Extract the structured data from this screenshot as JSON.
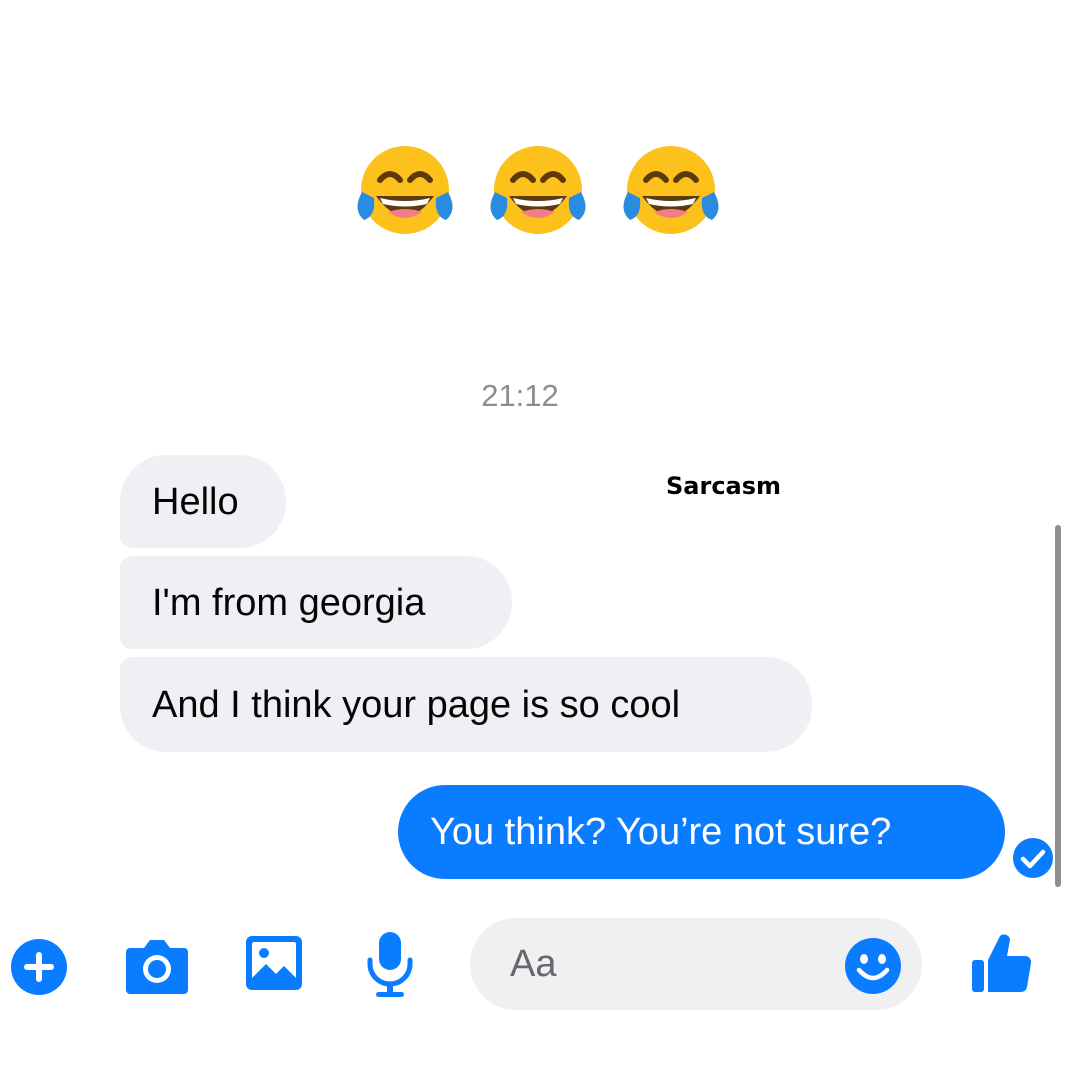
{
  "colors": {
    "accent": "#0a7cff",
    "incoming_bubble": "#f0eff4",
    "timestamp": "#8a8d91"
  },
  "reactions": [
    "face-with-tears-of-joy-icon",
    "face-with-tears-of-joy-icon",
    "face-with-tears-of-joy-icon"
  ],
  "conversation": {
    "timestamp": "21:12",
    "caption": "Sarcasm",
    "messages": [
      {
        "direction": "incoming",
        "text": "Hello"
      },
      {
        "direction": "incoming",
        "text": "I'm from georgia"
      },
      {
        "direction": "incoming",
        "text": "And I think your page is so cool"
      },
      {
        "direction": "outgoing",
        "text": "You think? You’re not sure?"
      }
    ],
    "read_receipt_icon": "check-circle-icon"
  },
  "composer": {
    "placeholder": "Aa",
    "icons": [
      "plus-icon",
      "camera-icon",
      "photo-icon",
      "microphone-icon",
      "smiley-icon",
      "thumbs-up-icon"
    ]
  }
}
